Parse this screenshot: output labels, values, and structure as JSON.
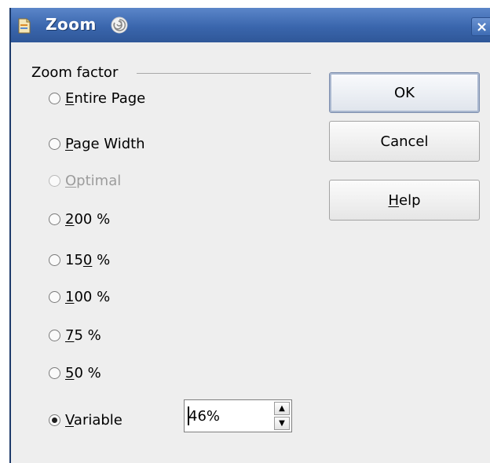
{
  "window": {
    "title": "Zoom",
    "close_label": "×",
    "icon": "document-icon",
    "title_decoration": "swirl-icon"
  },
  "group": {
    "label": "Zoom factor"
  },
  "options": [
    {
      "id": "entire-page",
      "label_underline": "E",
      "label_rest": "ntire Page",
      "selected": false,
      "disabled": false
    },
    {
      "id": "page-width",
      "label_underline": "P",
      "label_rest": "age Width",
      "selected": false,
      "disabled": false
    },
    {
      "id": "optimal",
      "label_underline": "O",
      "label_rest": "ptimal",
      "selected": false,
      "disabled": true
    },
    {
      "id": "200",
      "label_underline": "2",
      "label_rest": "00 %",
      "selected": false,
      "disabled": false
    },
    {
      "id": "150",
      "label_prefix": "15",
      "label_underline": "0",
      "label_rest": " %",
      "selected": false,
      "disabled": false
    },
    {
      "id": "100",
      "label_underline": "1",
      "label_rest": "00 %",
      "selected": false,
      "disabled": false
    },
    {
      "id": "75",
      "label_underline": "7",
      "label_rest": "5 %",
      "selected": false,
      "disabled": false
    },
    {
      "id": "50",
      "label_underline": "5",
      "label_rest": "0 %",
      "selected": false,
      "disabled": false
    },
    {
      "id": "variable",
      "label_underline": "V",
      "label_rest": "ariable",
      "selected": true,
      "disabled": false
    }
  ],
  "variable_field": {
    "value": "46%",
    "up_arrow": "▲",
    "down_arrow": "▼"
  },
  "buttons": {
    "ok": "OK",
    "cancel": "Cancel",
    "help_underline": "H",
    "help_rest": "elp"
  },
  "colors": {
    "titlebar": "#3a66ad",
    "dialog_bg": "#eeeeee",
    "disabled_text": "#9c9c9c"
  }
}
